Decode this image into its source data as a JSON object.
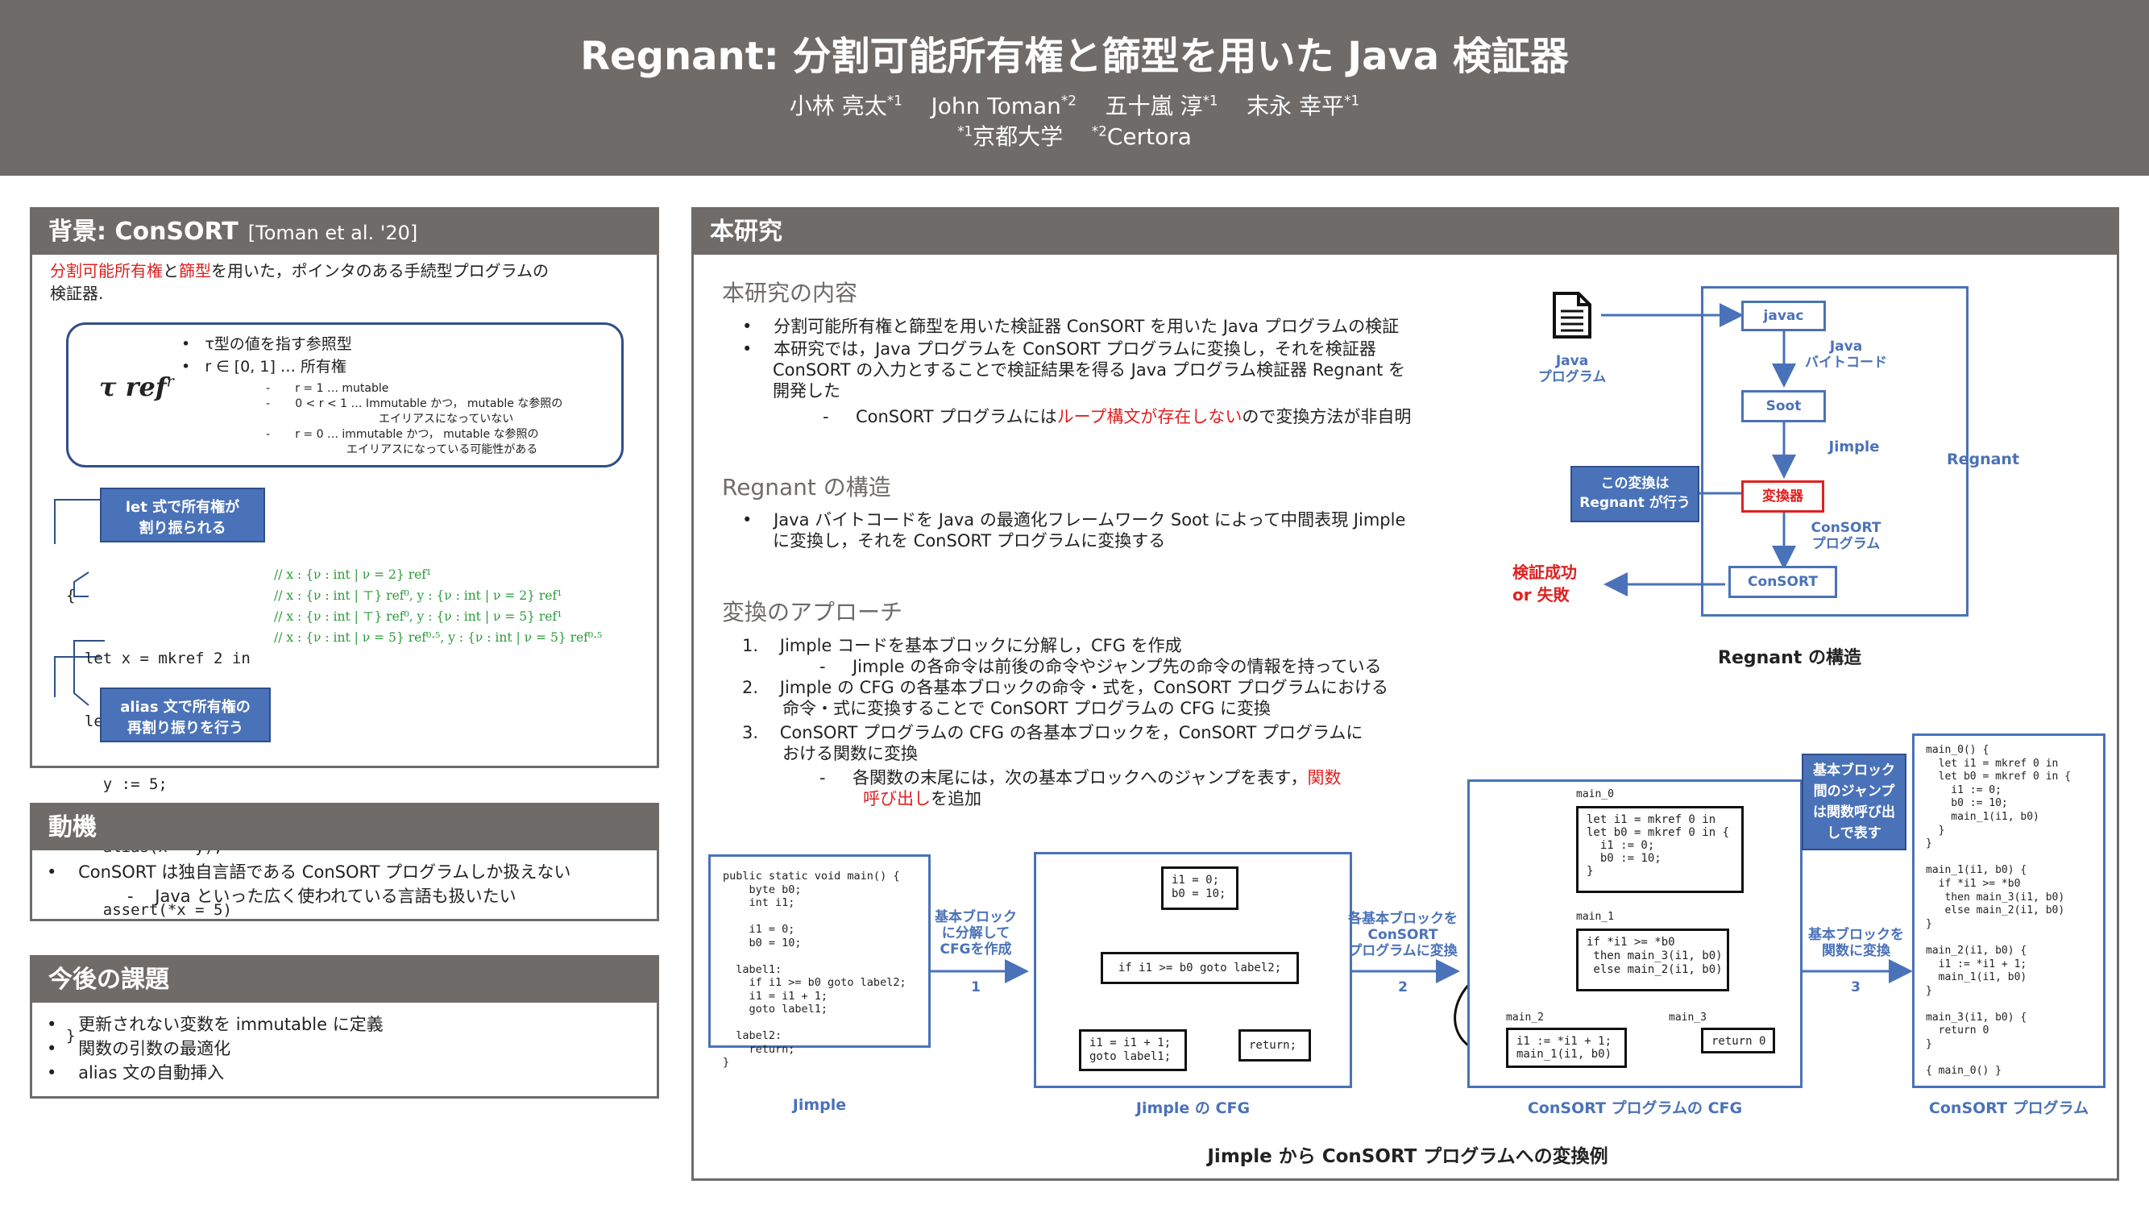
{
  "header": {
    "title": "Regnant: 分割可能所有権と篩型を用いた Java 検証器",
    "authors": [
      {
        "name": "小林 亮太",
        "mark": "*1"
      },
      {
        "name": "John Toman",
        "mark": "*2"
      },
      {
        "name": "五十嵐 淳",
        "mark": "*1"
      },
      {
        "name": "末永 幸平",
        "mark": "*1"
      }
    ],
    "affiliations": [
      {
        "mark": "*1",
        "name": "京都大学"
      },
      {
        "mark": "*2",
        "name": "Certora"
      }
    ]
  },
  "background": {
    "title": "背景: ConSORT",
    "cite": "[Toman et al. '20]",
    "intro_red1": "分割可能所有権",
    "intro_mid": "と",
    "intro_red2": "篩型",
    "intro_rest": "を用いた，ポインタのある手続型プログラムの",
    "intro_line2": "検証器.",
    "type_term": "τ ref",
    "type_sup": "r",
    "type_bullets": [
      "τ型の値を指す参照型",
      "r ∈ [0, 1] … 所有権"
    ],
    "type_sub": [
      "r = 1 … mutable",
      "0 < r < 1 … Immutable かつ， mutable な参照の",
      "エイリアスになっていない",
      "r = 0 … immutable かつ， mutable な参照の",
      "エイリアスになっている可能性がある"
    ],
    "label_let": [
      "let 式で所有権が",
      "割り振られる"
    ],
    "label_alias": [
      "alias 文で所有権の",
      "再割り振りを行う"
    ],
    "code_lines": [
      "{",
      "  let x = mkref 2 in",
      "  let y = x in {",
      "    y := 5;",
      "    alias(x = y);",
      "    assert(*x = 5)",
      "  }",
      "}"
    ],
    "comments": [
      "//  x : {ν : int | ν = 2} ref¹",
      "//  x : {ν : int | ⊤} ref⁰, y : {ν : int | ν = 2} ref¹",
      "//  x : {ν : int | ⊤} ref⁰, y : {ν : int | ν = 5} ref¹",
      "//  x : {ν : int | ν = 5} ref⁰·⁵, y : {ν : int | ν = 5} ref⁰·⁵"
    ]
  },
  "motivation": {
    "title": "動機",
    "items": [
      "ConSORT は独自言語である ConSORT プログラムしか扱えない"
    ],
    "sub": [
      "Java といった広く使われている言語も扱いたい"
    ]
  },
  "future": {
    "title": "今後の課題",
    "items": [
      "更新されない変数を immutable に定義",
      "関数の引数の最適化",
      "alias 文の自動挿入"
    ]
  },
  "main": {
    "title": "本研究",
    "content": {
      "heading": "本研究の内容",
      "items": [
        "分割可能所有権と篩型を用いた検証器 ConSORT を用いた Java プログラムの検証",
        "本研究では，Java プログラムを ConSORT プログラムに変換し，それを検証器",
        "ConSORT の入力とすることで検証結果を得る Java プログラム検証器 Regnant を",
        "開発した"
      ],
      "sub_pre": "ConSORT プログラムには",
      "sub_red": "ループ構文が存在しない",
      "sub_post": "ので変換方法が非自明"
    },
    "structure": {
      "heading": "Regnant の構造",
      "lines": [
        "Java バイトコードを Java の最適化フレームワーク Soot によって中間表現 Jimple",
        "に変換し，それを ConSORT プログラムに変換する"
      ]
    },
    "approach": {
      "heading": "変換のアプローチ",
      "steps": [
        {
          "num": "1.",
          "lines": [
            "Jimple コードを基本ブロックに分解し，CFG を作成"
          ],
          "sub": "Jimple の各命令は前後の命令やジャンプ先の命令の情報を持っている"
        },
        {
          "num": "2.",
          "lines": [
            "Jimple の CFG の各基本ブロックの命令・式を，ConSORT プログラムにおける",
            "命令・式に変換することで ConSORT プログラムの CFG に変換"
          ]
        },
        {
          "num": "3.",
          "lines": [
            "ConSORT プログラムの CFG の各基本ブロックを，ConSORT プログラムに",
            "おける関数に変換"
          ]
        }
      ],
      "sub3_pre": "各関数の末尾には，次の基本ブロックへのジャンプを表す，",
      "sub3_red": "関数",
      "sub3_red2": "呼び出し",
      "sub3_post": "を追加"
    },
    "diagram": {
      "caption": "Regnant の構造",
      "java_label": [
        "Java",
        "プログラム"
      ],
      "javac": "javac",
      "bytecode": [
        "Java",
        "バイトコード"
      ],
      "soot": "Soot",
      "jimple": "Jimple",
      "converter": "変換器",
      "consort_prog": [
        "ConSORT",
        "プログラム"
      ],
      "consort": "ConSORT",
      "regnant": "Regnant",
      "callout": [
        "この変換は",
        "Regnant が行う"
      ],
      "result": [
        "検証成功",
        "or 失敗"
      ]
    },
    "example": {
      "caption": "Jimple から ConSORT プログラムへの変換例",
      "jimple_code": "public static void main() {\n    byte b0;\n    int i1;\n\n    i1 = 0;\n    b0 = 10;\n\n  label1:\n    if i1 >= b0 goto label2;\n    i1 = i1 + 1;\n    goto label1;\n\n  label2:\n    return;\n}",
      "jimple_label": "Jimple",
      "arrow1": [
        "基本ブロック",
        "に分解して",
        "CFGを作成"
      ],
      "arrow1_num": "1",
      "cfg_blocks": [
        "i1 = 0;\nb0 = 10;",
        "if i1 >= b0 goto label2;",
        "i1 = i1 + 1;\ngoto label1;",
        "return;"
      ],
      "cfg_label": "Jimple の CFG",
      "arrow2": [
        "各基本ブロックを",
        "ConSORT",
        "プログラムに変換"
      ],
      "arrow2_num": "2",
      "ccfg_names": [
        "main_0",
        "main_1",
        "main_2",
        "main_3"
      ],
      "ccfg_blocks": [
        "let i1 = mkref 0 in\nlet b0 = mkref 0 in {\n  i1 := 0;\n  b0 := 10;\n}",
        "if *i1 >= *b0\n then main_3(i1, b0)\n else main_2(i1, b0)",
        "i1 := *i1 + 1;\nmain_1(i1, b0)",
        "return 0"
      ],
      "ccfg_label": "ConSORT プログラムの CFG",
      "arrow3": [
        "基本ブロックを",
        "関数に変換"
      ],
      "arrow3_num": "3",
      "callout": [
        "基本ブロック",
        "間のジャンプ",
        "は関数呼び出",
        "しで表す"
      ],
      "final_code": "main_0() {\n  let i1 = mkref 0 in\n  let b0 = mkref 0 in {\n    i1 := 0;\n    b0 := 10;\n    main_1(i1, b0)\n  }\n}\n\nmain_1(i1, b0) {\n  if *i1 >= *b0\n   then main_3(i1, b0)\n   else main_2(i1, b0)\n}\n\nmain_2(i1, b0) {\n  i1 := *i1 + 1;\n  main_1(i1, b0)\n}\n\nmain_3(i1, b0) {\n  return 0\n}\n\n{ main_0() }",
      "final_label": "ConSORT プログラム"
    }
  },
  "colors": {
    "header_bg": "#6e6b69",
    "accent_blue": "#4a72b8",
    "red": "#e02020",
    "green": "#2a9a3a"
  }
}
